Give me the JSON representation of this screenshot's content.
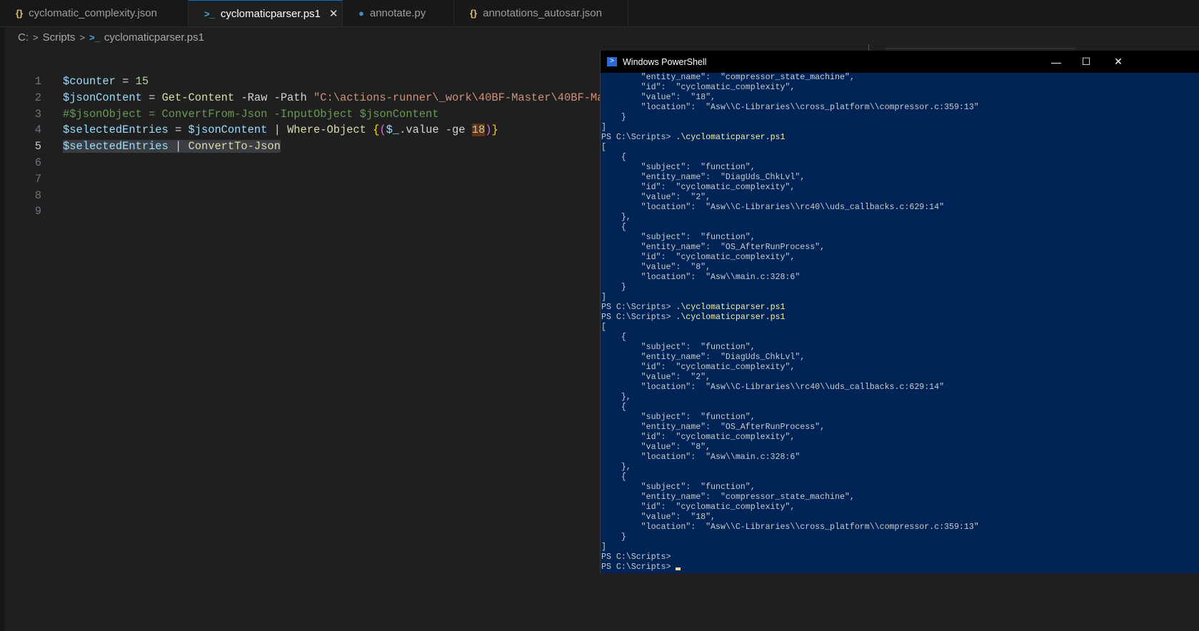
{
  "tabs": [
    {
      "label": "cyclomatic_complexity.json",
      "icon": "json-icon",
      "active": false
    },
    {
      "label": "cyclomaticparser.ps1",
      "icon": "powershell-icon",
      "active": true
    },
    {
      "label": "annotate.py",
      "icon": "python-icon",
      "active": false
    },
    {
      "label": "annotations_autosar.json",
      "icon": "json-icon",
      "active": false
    }
  ],
  "tab_close": "✕",
  "breadcrumb": {
    "drive": "C:",
    "folder": "Scripts",
    "file": "cyclomaticparser.ps1"
  },
  "editor": {
    "current_line": 5,
    "lines": [
      {
        "num": "1",
        "tokens": [
          {
            "t": "$counter",
            "c": "v"
          },
          {
            "t": " = ",
            "c": "o"
          },
          {
            "t": "15",
            "c": "n"
          }
        ]
      },
      {
        "num": "2",
        "tokens": [
          {
            "t": "$jsonContent",
            "c": "v"
          },
          {
            "t": " = ",
            "c": "o"
          },
          {
            "t": "Get-Content",
            "c": "f"
          },
          {
            "t": " -Raw -Path ",
            "c": "p"
          },
          {
            "t": "\"C:\\actions-runner\\_work\\40BF-Master\\40BF-Ma",
            "c": "s"
          }
        ]
      },
      {
        "num": "3",
        "tokens": [
          {
            "t": "#$jsonObject = ConvertFrom-Json -InputObject $jsonContent",
            "c": "c"
          }
        ]
      },
      {
        "num": "4",
        "tokens": [
          {
            "t": "$selectedEntries",
            "c": "v"
          },
          {
            "t": " = ",
            "c": "o"
          },
          {
            "t": "$jsonContent",
            "c": "v"
          },
          {
            "t": " | ",
            "c": "o"
          },
          {
            "t": "Where-Object",
            "c": "f"
          },
          {
            "t": " ",
            "c": "o"
          },
          {
            "t": "{",
            "c": "y"
          },
          {
            "t": "(",
            "c": "m"
          },
          {
            "t": "$_",
            "c": "v"
          },
          {
            "t": ".value -ge ",
            "c": "p"
          },
          {
            "t": "18",
            "c": "n hl"
          },
          {
            "t": ")",
            "c": "m"
          },
          {
            "t": "}",
            "c": "y"
          }
        ]
      },
      {
        "num": "5",
        "tokens": [
          {
            "t": "$selectedEntries",
            "c": "v sel"
          },
          {
            "t": " | ",
            "c": "o sel"
          },
          {
            "t": "ConvertTo-Json",
            "c": "f sel"
          }
        ]
      },
      {
        "num": "6",
        "tokens": []
      },
      {
        "num": "7",
        "tokens": []
      },
      {
        "num": "8",
        "tokens": []
      },
      {
        "num": "9",
        "tokens": []
      }
    ]
  },
  "powershell": {
    "title": "Windows PowerShell",
    "minimize": "—",
    "maximize": "☐",
    "close": "✕",
    "prompt": "PS C:\\Scripts> ",
    "lines": [
      {
        "text": "        \"entity_name\":  \"compressor_state_machine\","
      },
      {
        "text": "        \"id\":  \"cyclomatic_complexity\","
      },
      {
        "text": "        \"value\":  \"18\","
      },
      {
        "text": "        \"location\":  \"Asw\\\\C-Libraries\\\\cross_platform\\\\compressor.c:359:13\""
      },
      {
        "text": "    }"
      },
      {
        "text": "]"
      },
      {
        "prompt": true,
        "cmd": ".\\cyclomaticparser.ps1"
      },
      {
        "text": "["
      },
      {
        "text": "    {"
      },
      {
        "text": "        \"subject\":  \"function\","
      },
      {
        "text": "        \"entity_name\":  \"DiagUds_ChkLvl\","
      },
      {
        "text": "        \"id\":  \"cyclomatic_complexity\","
      },
      {
        "text": "        \"value\":  \"2\","
      },
      {
        "text": "        \"location\":  \"Asw\\\\C-Libraries\\\\rc40\\\\uds_callbacks.c:629:14\""
      },
      {
        "text": "    },"
      },
      {
        "text": "    {"
      },
      {
        "text": "        \"subject\":  \"function\","
      },
      {
        "text": "        \"entity_name\":  \"OS_AfterRunProcess\","
      },
      {
        "text": "        \"id\":  \"cyclomatic_complexity\","
      },
      {
        "text": "        \"value\":  \"8\","
      },
      {
        "text": "        \"location\":  \"Asw\\\\main.c:328:6\""
      },
      {
        "text": "    }"
      },
      {
        "text": "]"
      },
      {
        "prompt": true,
        "cmd": ".\\cyclomaticparser.ps1"
      },
      {
        "prompt": true,
        "cmd": ".\\cyclomaticparser.ps1"
      },
      {
        "text": "["
      },
      {
        "text": "    {"
      },
      {
        "text": "        \"subject\":  \"function\","
      },
      {
        "text": "        \"entity_name\":  \"DiagUds_ChkLvl\","
      },
      {
        "text": "        \"id\":  \"cyclomatic_complexity\","
      },
      {
        "text": "        \"value\":  \"2\","
      },
      {
        "text": "        \"location\":  \"Asw\\\\C-Libraries\\\\rc40\\\\uds_callbacks.c:629:14\""
      },
      {
        "text": "    },"
      },
      {
        "text": "    {"
      },
      {
        "text": "        \"subject\":  \"function\","
      },
      {
        "text": "        \"entity_name\":  \"OS_AfterRunProcess\","
      },
      {
        "text": "        \"id\":  \"cyclomatic_complexity\","
      },
      {
        "text": "        \"value\":  \"8\","
      },
      {
        "text": "        \"location\":  \"Asw\\\\main.c:328:6\""
      },
      {
        "text": "    },"
      },
      {
        "text": "    {"
      },
      {
        "text": "        \"subject\":  \"function\","
      },
      {
        "text": "        \"entity_name\":  \"compressor_state_machine\","
      },
      {
        "text": "        \"id\":  \"cyclomatic_complexity\","
      },
      {
        "text": "        \"value\":  \"18\","
      },
      {
        "text": "        \"location\":  \"Asw\\\\C-Libraries\\\\cross_platform\\\\compressor.c:359:13\""
      },
      {
        "text": "    }"
      },
      {
        "text": "]"
      },
      {
        "prompt": true,
        "cmd": ""
      },
      {
        "prompt": true,
        "cmd": "",
        "cursor": true
      }
    ]
  }
}
